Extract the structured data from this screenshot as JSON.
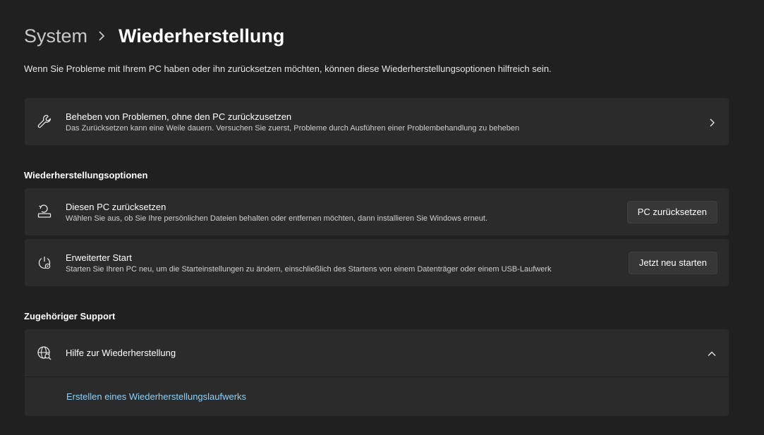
{
  "breadcrumb": {
    "parent": "System",
    "current": "Wiederherstellung"
  },
  "intro": "Wenn Sie Probleme mit Ihrem PC haben oder ihn zurücksetzen möchten, können diese Wiederherstellungsoptionen hilfreich sein.",
  "troubleshoot": {
    "title": "Beheben von Problemen, ohne den PC zurückzusetzen",
    "description": "Das Zurücksetzen kann eine Weile dauern. Versuchen Sie zuerst, Probleme durch Ausführen einer Problembehandlung zu beheben",
    "icon": "wrench-icon"
  },
  "recovery_options": {
    "heading": "Wiederherstellungsoptionen",
    "items": [
      {
        "title": "Diesen PC zurücksetzen",
        "description": "Wählen Sie aus, ob Sie Ihre persönlichen Dateien behalten oder entfernen möchten, dann installieren Sie Windows erneut.",
        "button": "PC zurücksetzen",
        "icon": "reset-pc-icon"
      },
      {
        "title": "Erweiterter Start",
        "description": "Starten Sie Ihren PC neu, um die Starteinstellungen zu ändern, einschließlich des Startens von einem Datenträger oder einem USB-Laufwerk",
        "button": "Jetzt neu starten",
        "icon": "advanced-startup-icon"
      }
    ]
  },
  "support": {
    "heading": "Zugehöriger Support",
    "title": "Hilfe zur Wiederherstellung",
    "icon": "globe-search-icon",
    "expanded": true,
    "link": "Erstellen eines Wiederherstellungslaufwerks"
  },
  "colors": {
    "background": "#202020",
    "card": "#2b2b2b",
    "link": "#8fd0f5"
  }
}
